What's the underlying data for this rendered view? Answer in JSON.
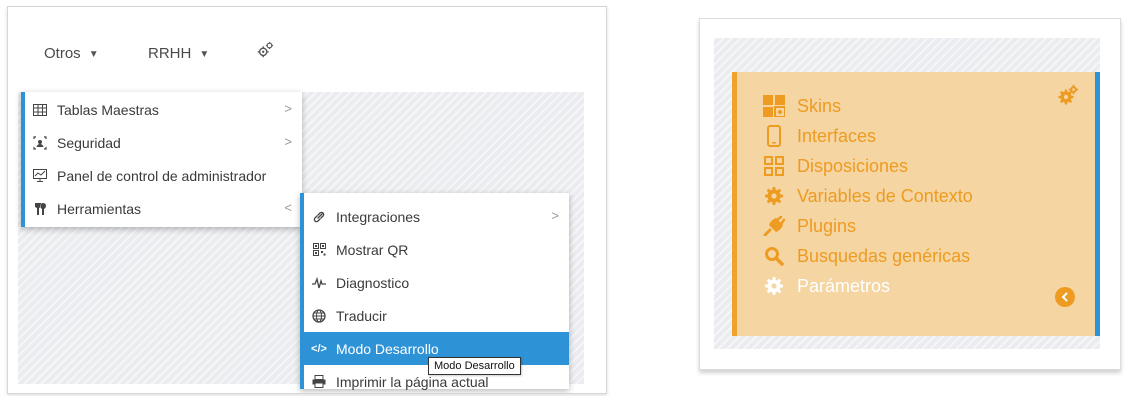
{
  "nav": {
    "items": [
      {
        "label": "Otros"
      },
      {
        "label": "RRHH"
      }
    ],
    "caret": "▼",
    "settings_icon": "cogs-icon"
  },
  "main_menu": {
    "items": [
      {
        "label": "Tablas Maestras",
        "icon": "table-icon",
        "submenu": true
      },
      {
        "label": "Seguridad",
        "icon": "security-icon",
        "submenu": true
      },
      {
        "label": "Panel de control de administrador",
        "icon": "dashboard-icon",
        "submenu": false
      },
      {
        "label": "Herramientas",
        "icon": "tools-icon",
        "submenu": true,
        "expanded": true
      }
    ]
  },
  "tools_menu": {
    "items": [
      {
        "label": "Integraciones",
        "icon": "link-icon",
        "submenu": true
      },
      {
        "label": "Mostrar QR",
        "icon": "qr-icon"
      },
      {
        "label": "Diagnostico",
        "icon": "heartbeat-icon"
      },
      {
        "label": "Traducir",
        "icon": "globe-icon"
      },
      {
        "label": "Modo Desarrollo",
        "icon": "code-icon",
        "active": true
      },
      {
        "label": "Imprimir la página actual",
        "icon": "print-icon"
      }
    ]
  },
  "tooltip": {
    "text": "Modo Desarrollo"
  },
  "right_menu": {
    "items": [
      {
        "label": "Skins",
        "icon": "skins-icon"
      },
      {
        "label": "Interfaces",
        "icon": "mobile-icon"
      },
      {
        "label": "Disposiciones",
        "icon": "layout-icon"
      },
      {
        "label": "Variables de Contexto",
        "icon": "cog-icon"
      },
      {
        "label": "Plugins",
        "icon": "plug-icon"
      },
      {
        "label": "Busquedas genéricas",
        "icon": "search-icon"
      },
      {
        "label": "Parámetros",
        "icon": "cog-icon",
        "highlight": true
      }
    ],
    "settings_icon": "cogs-icon",
    "collapse_icon": "chevron-left-icon"
  },
  "colors": {
    "accent_blue": "#2d93d6",
    "orange": "#ee9b21",
    "orange_bg": "#f5d5a2",
    "orange_border": "#f0a22c"
  }
}
